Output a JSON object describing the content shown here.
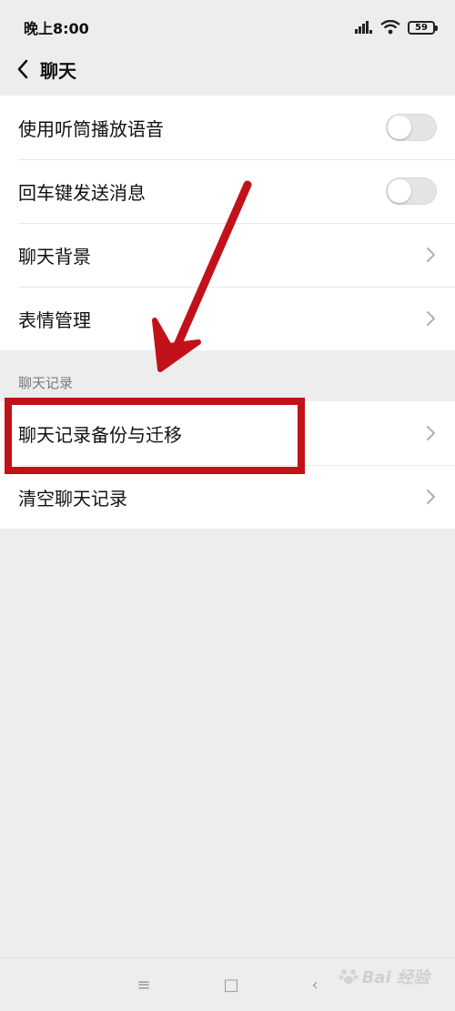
{
  "status": {
    "time": "晚上8:00",
    "battery": "59"
  },
  "nav": {
    "title": "聊天"
  },
  "settings": [
    {
      "label": "使用听筒播放语音",
      "control": "toggle",
      "on": false
    },
    {
      "label": "回车键发送消息",
      "control": "toggle",
      "on": false
    },
    {
      "label": "聊天背景",
      "control": "chevron"
    },
    {
      "label": "表情管理",
      "control": "chevron"
    }
  ],
  "history": {
    "header": "聊天记录",
    "items": [
      {
        "label": "聊天记录备份与迁移"
      },
      {
        "label": "清空聊天记录"
      }
    ]
  },
  "system_nav": {
    "menu": "≡",
    "home": "□",
    "back": "‹"
  },
  "watermark": {
    "text": "Bai 经验"
  },
  "annotation_color": "#c1121a"
}
